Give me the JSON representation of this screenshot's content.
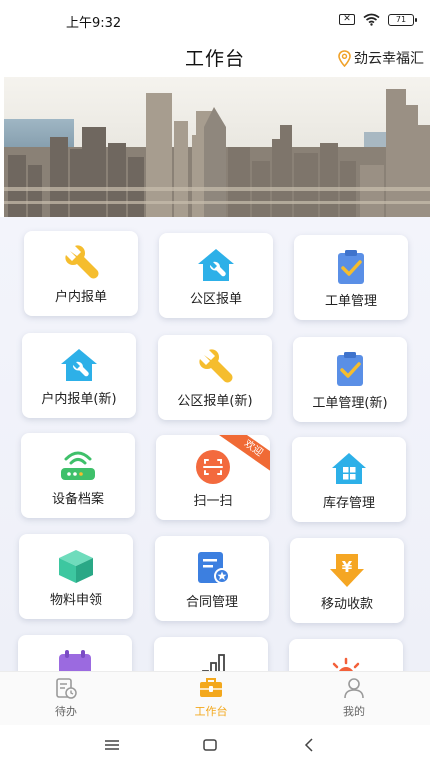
{
  "status_bar": {
    "time": "上午9:32",
    "battery": "71"
  },
  "header": {
    "title": "工作台",
    "location": "劲云幸福汇"
  },
  "grid": [
    {
      "label": "户内报单",
      "icon": "wrench-icon",
      "color": "#f5bd2e"
    },
    {
      "label": "公区报单",
      "icon": "house-wrench-icon",
      "color": "#2db0e8"
    },
    {
      "label": "工单管理",
      "icon": "clipboard-check-icon",
      "color": "#5a8fe6"
    },
    {
      "label": "户内报单(新)",
      "icon": "house-wrench-icon",
      "color": "#2db0e8"
    },
    {
      "label": "公区报单(新)",
      "icon": "wrench-icon",
      "color": "#f5bd2e"
    },
    {
      "label": "工单管理(新)",
      "icon": "clipboard-check-icon",
      "color": "#5a8fe6"
    },
    {
      "label": "设备档案",
      "icon": "router-icon",
      "color": "#3fc06a"
    },
    {
      "label": "扫一扫",
      "icon": "scan-icon",
      "color": "#f36a3e",
      "badge": "欢迎"
    },
    {
      "label": "库存管理",
      "icon": "house-grid-icon",
      "color": "#2db0e8"
    },
    {
      "label": "物料申领",
      "icon": "cube-icon",
      "color": "#3dc7a0"
    },
    {
      "label": "合同管理",
      "icon": "contract-icon",
      "color": "#3c7fe0"
    },
    {
      "label": "移动收款",
      "icon": "yen-arrow-icon",
      "color": "#f5a623"
    },
    {
      "label": "",
      "icon": "calendar-icon",
      "color": "#9b6ae0"
    },
    {
      "label": "",
      "icon": "bar-chart-icon",
      "color": "#444444"
    },
    {
      "label": "",
      "icon": "sun-icon",
      "color": "#f3603a"
    }
  ],
  "bottom_nav": [
    {
      "label": "待办",
      "icon": "todo-icon"
    },
    {
      "label": "工作台",
      "icon": "toolbox-icon",
      "active": true
    },
    {
      "label": "我的",
      "icon": "person-icon"
    }
  ],
  "colors": {
    "accent": "#f3a81d",
    "background": "#eff1f8"
  }
}
